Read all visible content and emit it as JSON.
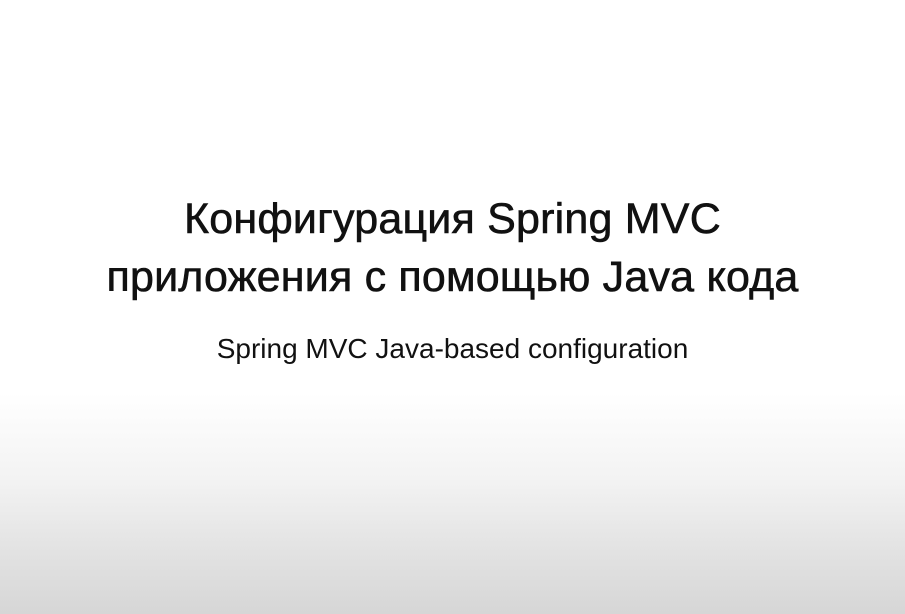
{
  "slide": {
    "title_line_1": "Конфигурация Spring MVC",
    "title_line_2": "приложения с помощью Java кода",
    "subtitle": "Spring MVC Java-based configuration"
  }
}
